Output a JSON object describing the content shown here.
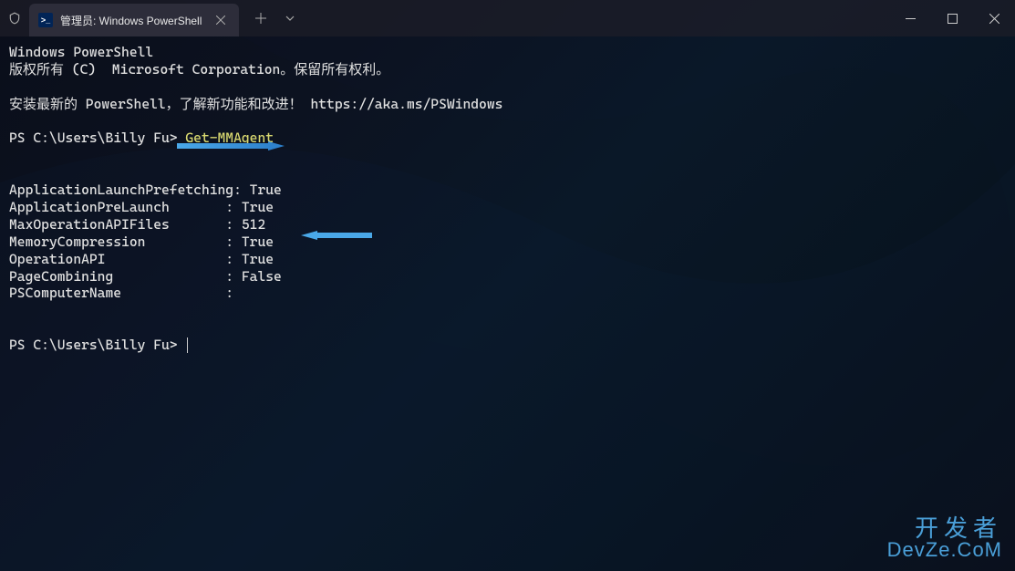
{
  "titlebar": {
    "tab_icon_text": ">_",
    "tab_title": "管理员: Windows PowerShell"
  },
  "terminal": {
    "header_line1": "Windows PowerShell",
    "header_line2": "版权所有 (C)  Microsoft Corporation。保留所有权利。",
    "install_line": "安装最新的 PowerShell，了解新功能和改进！ https://aka.ms/PSWindows",
    "prompt1_prefix": "PS C:\\Users\\Billy Fu> ",
    "command1": "Get-MMAgent",
    "output_rows": [
      {
        "key": "ApplicationLaunchPrefetching",
        "value": "True"
      },
      {
        "key": "ApplicationPreLaunch",
        "value": "True"
      },
      {
        "key": "MaxOperationAPIFiles",
        "value": "512"
      },
      {
        "key": "MemoryCompression",
        "value": "True"
      },
      {
        "key": "OperationAPI",
        "value": "True"
      },
      {
        "key": "PageCombining",
        "value": "False"
      },
      {
        "key": "PSComputerName",
        "value": ""
      }
    ],
    "prompt2_prefix": "PS C:\\Users\\Billy Fu> "
  },
  "watermark": {
    "line1": "开发者",
    "line2": "DevZe.CoM"
  }
}
